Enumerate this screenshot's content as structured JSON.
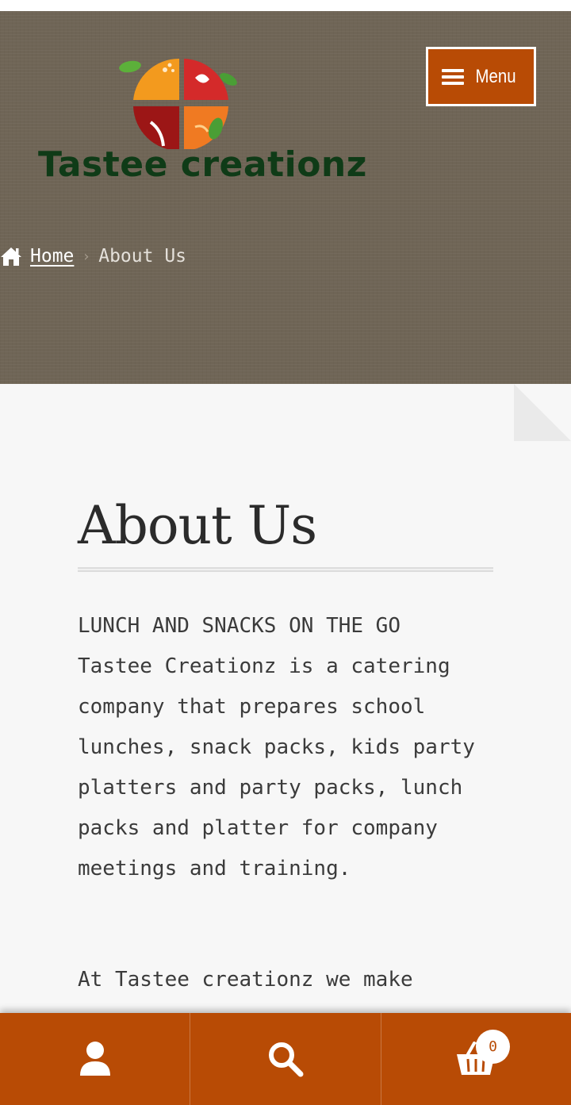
{
  "header": {
    "site_title": "Tastee creationz",
    "menu_label": "Menu",
    "background_color": "#6f6556",
    "accent_color": "#b84b05"
  },
  "breadcrumb": {
    "home_label": "Home",
    "separator": "›",
    "current": "About Us"
  },
  "main": {
    "page_title": "About Us",
    "paragraph1": "LUNCH AND SNACKS ON THE GO\nTastee Creationz is a catering company that prepares school lunches, snack packs, kids party platters and party packs, lunch packs and platter for company meetings and training.",
    "paragraph2": "At Tastee creationz we make"
  },
  "bottom_nav": {
    "items": [
      {
        "icon": "user-icon"
      },
      {
        "icon": "search-icon"
      },
      {
        "icon": "cart-icon"
      }
    ],
    "cart_count": "0"
  }
}
